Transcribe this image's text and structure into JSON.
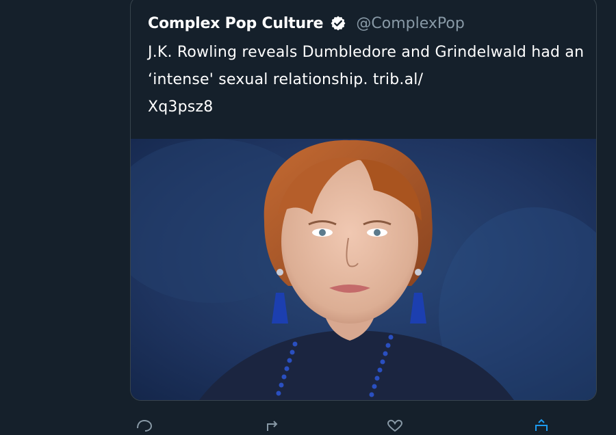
{
  "quoted_tweet": {
    "display_name": "Complex Pop Culture",
    "verified_icon": "verified-badge-icon",
    "handle": "@ComplexPop",
    "text": "J.K. Rowling reveals Dumbledore and Grindelwald had an ‘intense' sexual relationship. trib.al/\nXq3psz8",
    "media": {
      "kind": "photo",
      "background_color": "#20365c",
      "hair_color": "#b05a2a",
      "skin_color": "#e3b79f",
      "earring_color": "#1c3fb0"
    }
  },
  "actions": {
    "icons": [
      "reply-icon",
      "retweet-icon",
      "like-icon",
      "share-icon"
    ]
  },
  "colors": {
    "background": "#15202b",
    "border": "#38444d",
    "text": "#ffffff",
    "secondary_text": "#8899a6"
  }
}
